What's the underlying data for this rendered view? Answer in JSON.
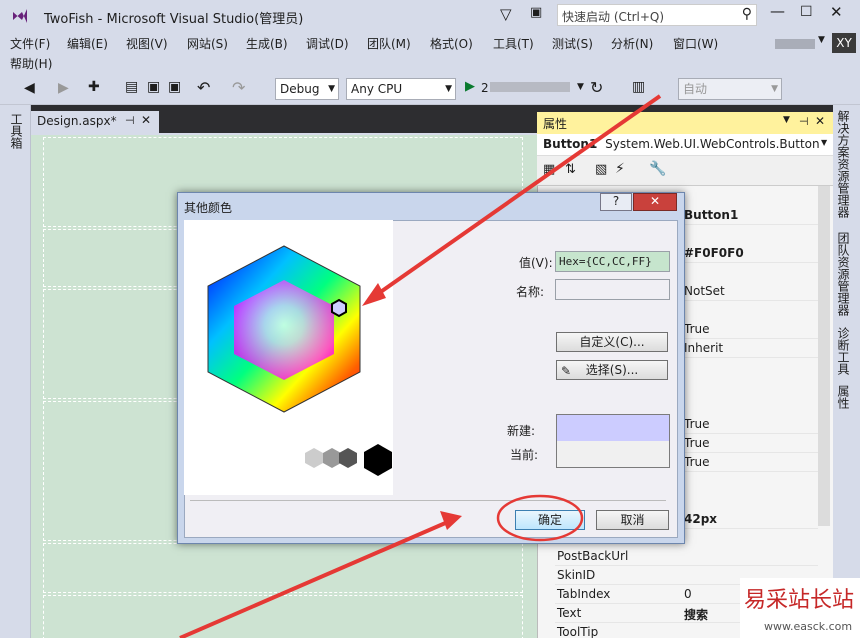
{
  "titlebar": {
    "title": "TwoFish - Microsoft Visual Studio(管理员)",
    "quick_launch_placeholder": "快速启动 (Ctrl+Q)",
    "user_initials": "XY"
  },
  "menu": [
    "文件(F)",
    "编辑(E)",
    "视图(V)",
    "网站(S)",
    "生成(B)",
    "调试(D)",
    "团队(M)",
    "格式(O)",
    "工具(T)",
    "测试(S)",
    "分析(N)",
    "窗口(W)",
    "帮助(H)"
  ],
  "toolbar": {
    "config": "Debug",
    "platform": "Any CPU",
    "run_label": "2",
    "auto": "自动"
  },
  "left_tool": {
    "label": "工具箱"
  },
  "document": {
    "tab_label": "Design.aspx*"
  },
  "properties": {
    "title": "属性",
    "object": "Button1",
    "object_type": "System.Web.UI.WebControls.Button",
    "rows": [
      {
        "k": "",
        "v": "Button1"
      },
      {
        "k": "",
        "v": "#F0F0F0"
      },
      {
        "k": "",
        "v": "NotSet"
      },
      {
        "k": "",
        "v": "True"
      },
      {
        "k": "",
        "v": "Inherit"
      },
      {
        "k": "",
        "v": "True"
      },
      {
        "k": "",
        "v": "True"
      },
      {
        "k": "",
        "v": "True"
      },
      {
        "k": "",
        "v": "42px"
      },
      {
        "k": "PostBackUrl",
        "v": ""
      },
      {
        "k": "SkinID",
        "v": ""
      },
      {
        "k": "TabIndex",
        "v": "0"
      },
      {
        "k": "Text",
        "v": "搜索"
      },
      {
        "k": "ToolTip",
        "v": ""
      }
    ]
  },
  "right_tabs": [
    "解决方案资源管理器",
    "团队资源管理器",
    "诊断工具",
    "属性"
  ],
  "dialog": {
    "title": "其他颜色",
    "value_label": "值(V):",
    "value": "Hex={CC,CC,FF}",
    "name_label": "名称:",
    "custom_button": "自定义(C)...",
    "pick_button": "选择(S)...",
    "new_label": "新建:",
    "current_label": "当前:",
    "ok_button": "确定",
    "cancel_button": "取消",
    "new_color": "#CCCCFF",
    "current_color": "#F0F0F0"
  },
  "watermark": {
    "text": "易采站长站",
    "url": "www.easck.com"
  }
}
